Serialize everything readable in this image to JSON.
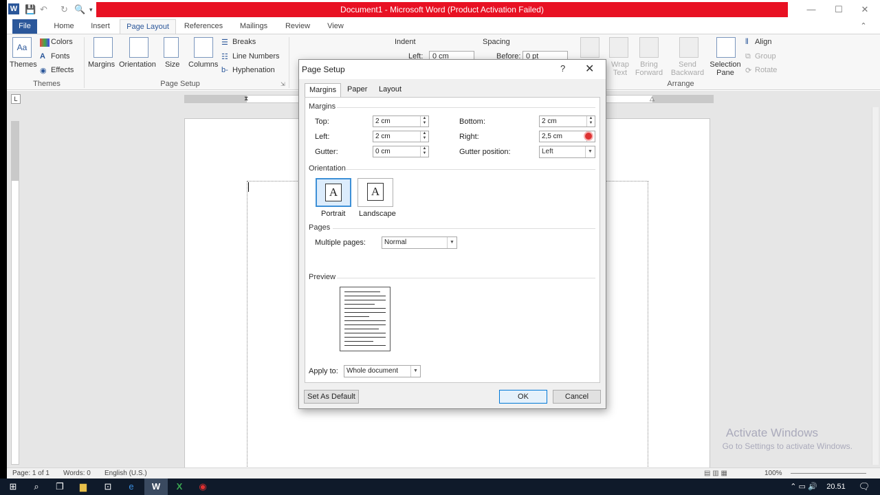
{
  "window": {
    "title": "Document1 - Microsoft Word (Product Activation Failed)",
    "app_icon": "W"
  },
  "ribbon_tabs": [
    "File",
    "Home",
    "Insert",
    "Page Layout",
    "References",
    "Mailings",
    "Review",
    "View"
  ],
  "active_tab": "Page Layout",
  "ribbon": {
    "themes_group": {
      "label": "Themes",
      "themes": "Themes",
      "colors": "Colors",
      "fonts": "Fonts",
      "effects": "Effects"
    },
    "page_setup_group": {
      "label": "Page Setup",
      "margins": "Margins",
      "orientation": "Orientation",
      "size": "Size",
      "columns": "Columns",
      "breaks": "Breaks",
      "line_numbers": "Line Numbers",
      "hyphenation": "Hyphenation"
    },
    "indent": {
      "label": "Indent",
      "left_label": "Left:",
      "left_value": "0 cm"
    },
    "spacing": {
      "label": "Spacing",
      "before_label": "Before:",
      "before_value": "0 pt"
    },
    "arrange_group": {
      "label": "Arrange",
      "wrap_text": "Wrap Text",
      "bring_forward": "Bring Forward",
      "send_backward": "Send Backward",
      "selection_pane": "Selection Pane",
      "align": "Align",
      "group": "Group",
      "rotate": "Rotate"
    }
  },
  "dialog": {
    "title": "Page Setup",
    "help": "?",
    "close": "✕",
    "tabs": [
      "Margins",
      "Paper",
      "Layout"
    ],
    "active_tab": "Margins",
    "margins": {
      "section": "Margins",
      "top_label": "Top:",
      "top_value": "2 cm",
      "bottom_label": "Bottom:",
      "bottom_value": "2 cm",
      "left_label": "Left:",
      "left_value": "2 cm",
      "right_label": "Right:",
      "right_value": "2,5 cm",
      "gutter_label": "Gutter:",
      "gutter_value": "0 cm",
      "gutter_position_label": "Gutter position:",
      "gutter_position_value": "Left"
    },
    "orientation": {
      "section": "Orientation",
      "portrait": "Portrait",
      "landscape": "Landscape",
      "selected": "Portrait"
    },
    "pages": {
      "section": "Pages",
      "multiple_pages_label": "Multiple pages:",
      "multiple_pages_value": "Normal"
    },
    "preview": {
      "section": "Preview"
    },
    "apply_to_label": "Apply to:",
    "apply_to_value": "Whole document",
    "set_default": "Set As Default",
    "ok": "OK",
    "cancel": "Cancel"
  },
  "statusbar": {
    "page": "Page: 1 of 1",
    "words": "Words: 0",
    "language": "English (U.S.)",
    "zoom": "100%"
  },
  "watermark": {
    "line1": "Activate Windows",
    "line2": "Go to Settings to activate Windows."
  },
  "taskbar": {
    "time": "20.51"
  },
  "colors": {
    "accent": "#2b579a",
    "title_red": "#e81123",
    "selection_blue": "#3c8fd6"
  }
}
